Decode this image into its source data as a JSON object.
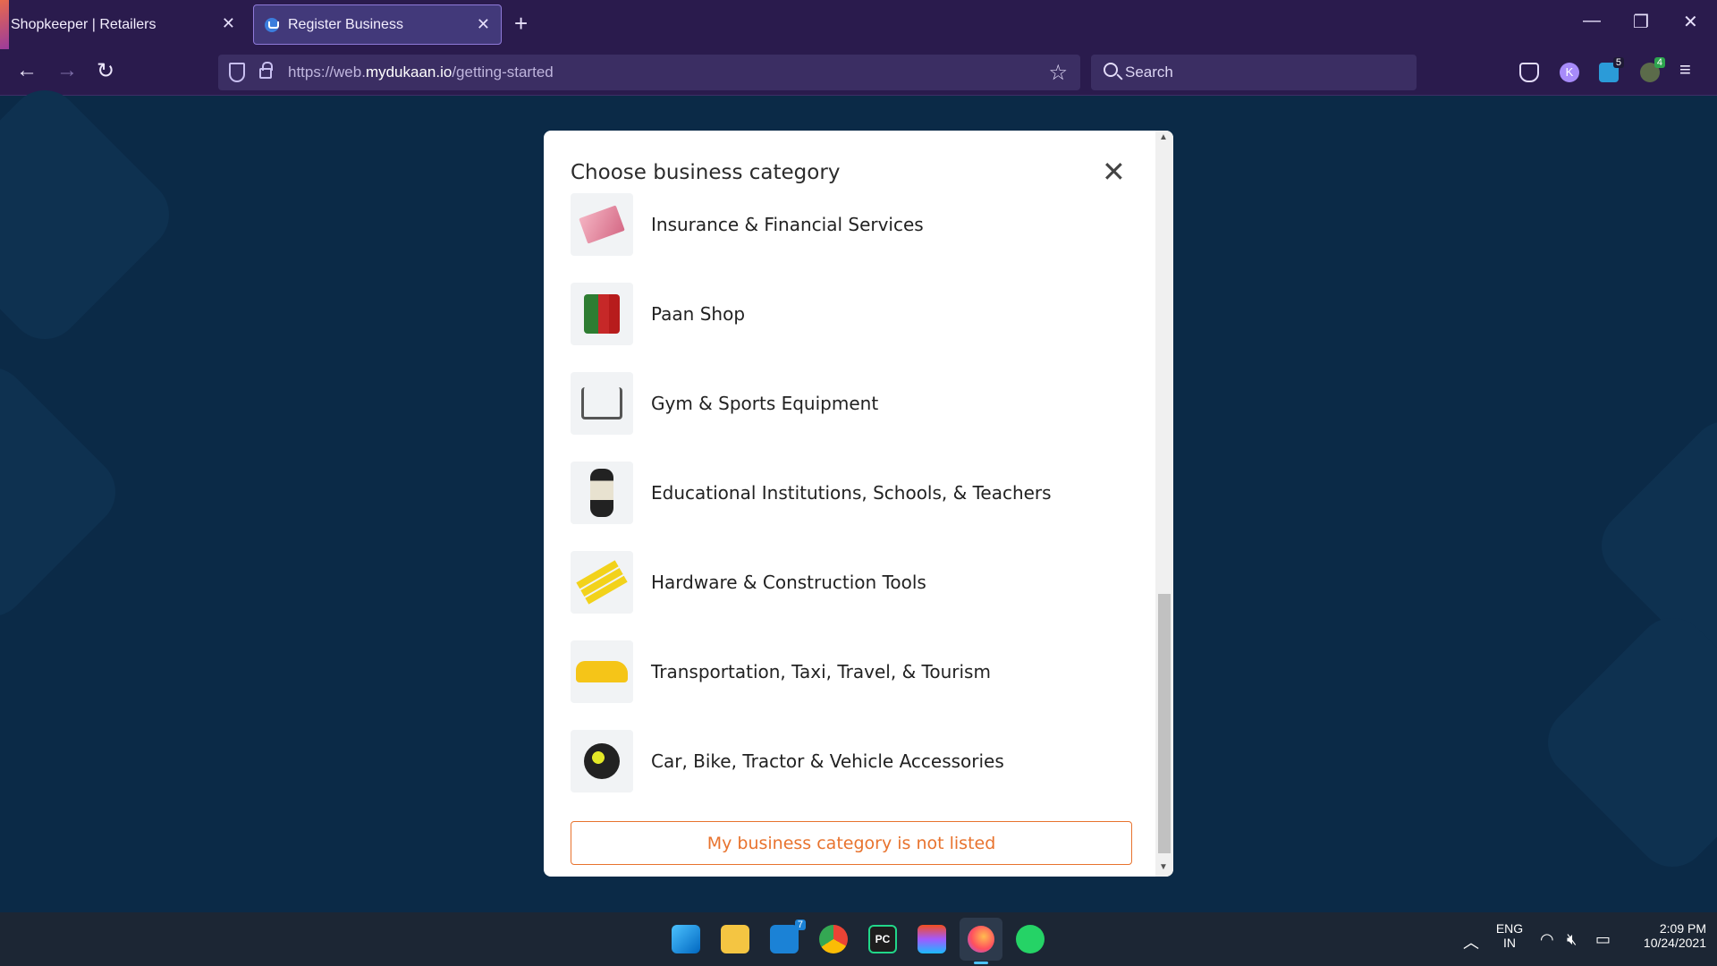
{
  "browser": {
    "tabs": [
      {
        "label": "Shopkeeper | Retailers",
        "active": false
      },
      {
        "label": "Register Business",
        "active": true
      }
    ],
    "url_prefix": "https://web.",
    "url_domain": "mydukaan.io",
    "url_path": "/getting-started",
    "search_placeholder": "Search",
    "badges": {
      "extension_1": "5",
      "extension_2": "4"
    }
  },
  "modal": {
    "title": "Choose business category",
    "categories": [
      {
        "label": "Insurance & Financial Services",
        "icon": "money-icon"
      },
      {
        "label": "Paan Shop",
        "icon": "paan-icon"
      },
      {
        "label": "Gym & Sports Equipment",
        "icon": "gym-icon"
      },
      {
        "label": "Educational Institutions, Schools, & Teachers",
        "icon": "teacher-icon"
      },
      {
        "label": "Hardware & Construction Tools",
        "icon": "tools-icon"
      },
      {
        "label": "Transportation, Taxi, Travel, & Tourism",
        "icon": "taxi-icon"
      },
      {
        "label": "Car, Bike, Tractor & Vehicle Accessories",
        "icon": "helmet-icon"
      }
    ],
    "not_listed_label": "My business category is not listed"
  },
  "taskbar": {
    "mail_badge": "7",
    "lang_1": "ENG",
    "lang_2": "IN",
    "time": "2:09 PM",
    "date": "10/24/2021"
  },
  "colors": {
    "page_bg": "#0b2a47",
    "chrome_bg": "#2a1b4d",
    "accent": "#e8732e"
  }
}
